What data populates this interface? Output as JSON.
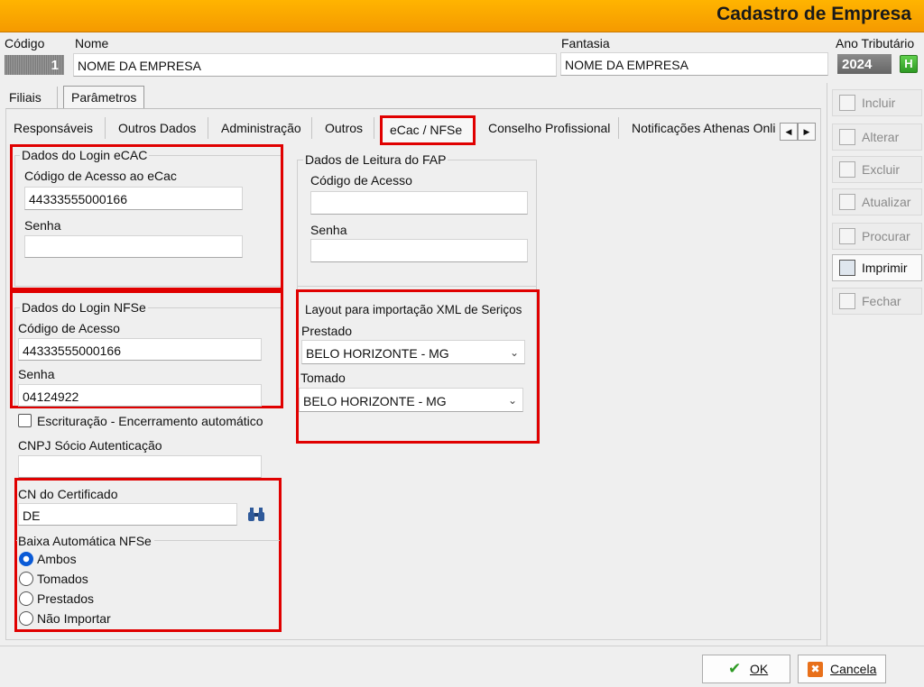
{
  "window": {
    "title": "Cadastro de Empresa"
  },
  "header": {
    "codigo_label": "Código",
    "codigo_value": "1",
    "nome_label": "Nome",
    "nome_value": "NOME DA EMPRESA",
    "fantasia_label": "Fantasia",
    "fantasia_value": "NOME DA EMPRESA",
    "ano_label": "Ano Tributário",
    "ano_value": "2024",
    "ano_btn": "H"
  },
  "main_tabs": [
    "Filiais",
    "Parâmetros"
  ],
  "sub_tabs": [
    "Responsáveis",
    "Outros Dados",
    "Administração",
    "Outros",
    "eCac / NFSe",
    "Conselho Profissional",
    "Notificações Athenas Onli"
  ],
  "ecac": {
    "group_title": "Dados do Login eCAC",
    "codigo_label": "Código de Acesso ao eCac",
    "codigo_value": "44333555000166",
    "senha_label": "Senha",
    "senha_value": ""
  },
  "nfse": {
    "group_title": "Dados do Login NFSe",
    "codigo_label": "Código de Acesso",
    "codigo_value": "44333555000166",
    "senha_label": "Senha",
    "senha_value": "04124922"
  },
  "escrituracao_label": "Escrituração - Encerramento automático",
  "cnpj": {
    "label": "CNPJ Sócio Autenticação",
    "value": ""
  },
  "certificado": {
    "label": "CN do Certificado",
    "value": "DE"
  },
  "baixa": {
    "group_title": "Baixa Automática NFSe",
    "options": [
      "Ambos",
      "Tomados",
      "Prestados",
      "Não Importar"
    ],
    "selected": "Ambos"
  },
  "fap": {
    "group_title": "Dados de Leitura do FAP",
    "codigo_label": "Código de Acesso",
    "codigo_value": "",
    "senha_label": "Senha",
    "senha_value": ""
  },
  "layout_xml": {
    "group_title": "Layout para importação XML de Seriços",
    "prestado_label": "Prestado",
    "prestado_value": "BELO HORIZONTE - MG",
    "tomado_label": "Tomado",
    "tomado_value": "BELO HORIZONTE - MG"
  },
  "sidebar": [
    "Incluir",
    "Alterar",
    "Excluir",
    "Atualizar",
    "Procurar",
    "Imprimir",
    "Fechar"
  ],
  "footer": {
    "ok": "OK",
    "cancel": "Cancela"
  },
  "colors": {
    "titlebar": "#f5a000",
    "highlight": "#e00000",
    "radio_selected": "#0a5ad6"
  }
}
